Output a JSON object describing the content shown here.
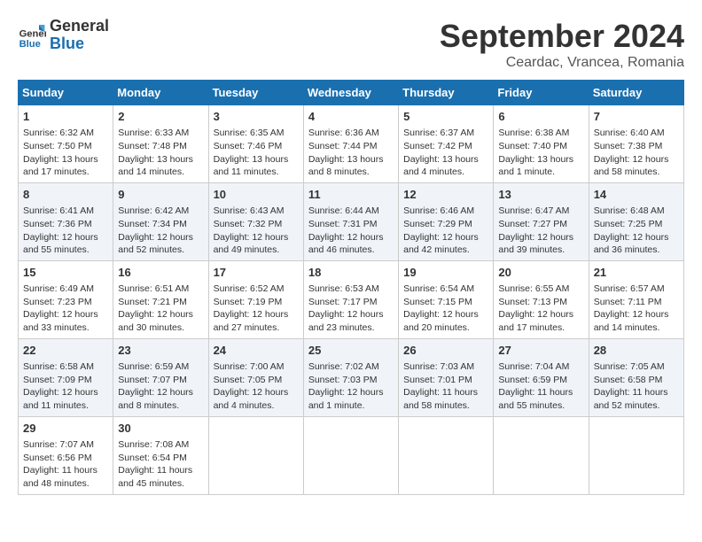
{
  "logo": {
    "line1": "General",
    "line2": "Blue"
  },
  "title": "September 2024",
  "location": "Ceardac, Vrancea, Romania",
  "days_of_week": [
    "Sunday",
    "Monday",
    "Tuesday",
    "Wednesday",
    "Thursday",
    "Friday",
    "Saturday"
  ],
  "weeks": [
    [
      {
        "day": "1",
        "info": "Sunrise: 6:32 AM\nSunset: 7:50 PM\nDaylight: 13 hours\nand 17 minutes."
      },
      {
        "day": "2",
        "info": "Sunrise: 6:33 AM\nSunset: 7:48 PM\nDaylight: 13 hours\nand 14 minutes."
      },
      {
        "day": "3",
        "info": "Sunrise: 6:35 AM\nSunset: 7:46 PM\nDaylight: 13 hours\nand 11 minutes."
      },
      {
        "day": "4",
        "info": "Sunrise: 6:36 AM\nSunset: 7:44 PM\nDaylight: 13 hours\nand 8 minutes."
      },
      {
        "day": "5",
        "info": "Sunrise: 6:37 AM\nSunset: 7:42 PM\nDaylight: 13 hours\nand 4 minutes."
      },
      {
        "day": "6",
        "info": "Sunrise: 6:38 AM\nSunset: 7:40 PM\nDaylight: 13 hours\nand 1 minute."
      },
      {
        "day": "7",
        "info": "Sunrise: 6:40 AM\nSunset: 7:38 PM\nDaylight: 12 hours\nand 58 minutes."
      }
    ],
    [
      {
        "day": "8",
        "info": "Sunrise: 6:41 AM\nSunset: 7:36 PM\nDaylight: 12 hours\nand 55 minutes."
      },
      {
        "day": "9",
        "info": "Sunrise: 6:42 AM\nSunset: 7:34 PM\nDaylight: 12 hours\nand 52 minutes."
      },
      {
        "day": "10",
        "info": "Sunrise: 6:43 AM\nSunset: 7:32 PM\nDaylight: 12 hours\nand 49 minutes."
      },
      {
        "day": "11",
        "info": "Sunrise: 6:44 AM\nSunset: 7:31 PM\nDaylight: 12 hours\nand 46 minutes."
      },
      {
        "day": "12",
        "info": "Sunrise: 6:46 AM\nSunset: 7:29 PM\nDaylight: 12 hours\nand 42 minutes."
      },
      {
        "day": "13",
        "info": "Sunrise: 6:47 AM\nSunset: 7:27 PM\nDaylight: 12 hours\nand 39 minutes."
      },
      {
        "day": "14",
        "info": "Sunrise: 6:48 AM\nSunset: 7:25 PM\nDaylight: 12 hours\nand 36 minutes."
      }
    ],
    [
      {
        "day": "15",
        "info": "Sunrise: 6:49 AM\nSunset: 7:23 PM\nDaylight: 12 hours\nand 33 minutes."
      },
      {
        "day": "16",
        "info": "Sunrise: 6:51 AM\nSunset: 7:21 PM\nDaylight: 12 hours\nand 30 minutes."
      },
      {
        "day": "17",
        "info": "Sunrise: 6:52 AM\nSunset: 7:19 PM\nDaylight: 12 hours\nand 27 minutes."
      },
      {
        "day": "18",
        "info": "Sunrise: 6:53 AM\nSunset: 7:17 PM\nDaylight: 12 hours\nand 23 minutes."
      },
      {
        "day": "19",
        "info": "Sunrise: 6:54 AM\nSunset: 7:15 PM\nDaylight: 12 hours\nand 20 minutes."
      },
      {
        "day": "20",
        "info": "Sunrise: 6:55 AM\nSunset: 7:13 PM\nDaylight: 12 hours\nand 17 minutes."
      },
      {
        "day": "21",
        "info": "Sunrise: 6:57 AM\nSunset: 7:11 PM\nDaylight: 12 hours\nand 14 minutes."
      }
    ],
    [
      {
        "day": "22",
        "info": "Sunrise: 6:58 AM\nSunset: 7:09 PM\nDaylight: 12 hours\nand 11 minutes."
      },
      {
        "day": "23",
        "info": "Sunrise: 6:59 AM\nSunset: 7:07 PM\nDaylight: 12 hours\nand 8 minutes."
      },
      {
        "day": "24",
        "info": "Sunrise: 7:00 AM\nSunset: 7:05 PM\nDaylight: 12 hours\nand 4 minutes."
      },
      {
        "day": "25",
        "info": "Sunrise: 7:02 AM\nSunset: 7:03 PM\nDaylight: 12 hours\nand 1 minute."
      },
      {
        "day": "26",
        "info": "Sunrise: 7:03 AM\nSunset: 7:01 PM\nDaylight: 11 hours\nand 58 minutes."
      },
      {
        "day": "27",
        "info": "Sunrise: 7:04 AM\nSunset: 6:59 PM\nDaylight: 11 hours\nand 55 minutes."
      },
      {
        "day": "28",
        "info": "Sunrise: 7:05 AM\nSunset: 6:58 PM\nDaylight: 11 hours\nand 52 minutes."
      }
    ],
    [
      {
        "day": "29",
        "info": "Sunrise: 7:07 AM\nSunset: 6:56 PM\nDaylight: 11 hours\nand 48 minutes."
      },
      {
        "day": "30",
        "info": "Sunrise: 7:08 AM\nSunset: 6:54 PM\nDaylight: 11 hours\nand 45 minutes."
      },
      {
        "day": "",
        "info": ""
      },
      {
        "day": "",
        "info": ""
      },
      {
        "day": "",
        "info": ""
      },
      {
        "day": "",
        "info": ""
      },
      {
        "day": "",
        "info": ""
      }
    ]
  ]
}
